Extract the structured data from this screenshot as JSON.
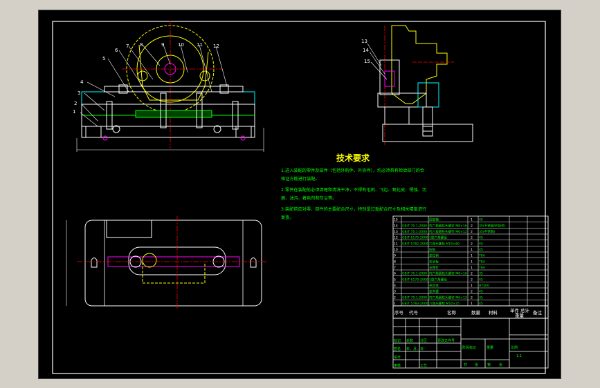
{
  "drawing": {
    "tech_title": "技术要求",
    "tech_lines": [
      "1.进入装配的零件及部件（包括外购件、外协件），均必须具有检验部门的合",
      "格证方能进行装配。",
      "2.零件在装配前必须清理和清洗干净，不得有毛刺、飞边、氧化皮、锈蚀、切",
      "屑、油污、着色剂和灰尘等。",
      "3.装配前应对零、部件的主要配合尺寸，特别是过盈配合尺寸及相关精度进行",
      "复查。"
    ],
    "callouts_front": [
      "1",
      "2",
      "3",
      "4",
      "5",
      "6",
      "7",
      "8",
      "9",
      "10",
      "11",
      "12"
    ],
    "callouts_side": [
      "13",
      "14",
      "15"
    ],
    "bom_rows": [
      {
        "no": "15",
        "code": "",
        "name": "固定轴",
        "qty": "1",
        "mat": "45",
        "note": ""
      },
      {
        "no": "14",
        "code": "GB/T 70.1-2000",
        "name": "内六角圆柱头螺钉 M8×16",
        "qty": "2",
        "mat": "35(不锈钢/外协件)",
        "note": ""
      },
      {
        "no": "13",
        "code": "GB/T 70.1-2000",
        "name": "内六角圆柱头螺钉 M6×12",
        "qty": "2",
        "mat": "35(不锈钢)",
        "note": ""
      },
      {
        "no": "12",
        "code": "GB/T 6170-2000",
        "name": "1型六角螺母",
        "qty": "2",
        "mat": "45",
        "note": ""
      },
      {
        "no": "11",
        "code": "GB/T 5782-2000",
        "name": "六角头螺栓 M10×80",
        "qty": "2",
        "mat": "45",
        "note": ""
      },
      {
        "no": "10",
        "code": "",
        "name": "压板",
        "qty": "1",
        "mat": "45",
        "note": ""
      },
      {
        "no": "9",
        "code": "",
        "name": "定位销",
        "qty": "1",
        "mat": "T8A",
        "note": ""
      },
      {
        "no": "8",
        "code": "",
        "name": "支承板",
        "qty": "1",
        "mat": "T8A",
        "note": ""
      },
      {
        "no": "7",
        "code": "",
        "name": "支撑钉",
        "qty": "1",
        "mat": "T8A",
        "note": ""
      },
      {
        "no": "6",
        "code": "GB/T 70.1-2000",
        "name": "内六角圆柱头螺钉 M8×16",
        "qty": "2",
        "mat": "35",
        "note": ""
      },
      {
        "no": "5",
        "code": "GB/T 6170-2000",
        "name": "1型六角螺母",
        "qty": "2",
        "mat": "45",
        "note": ""
      },
      {
        "no": "4",
        "code": "",
        "name": "夹具体",
        "qty": "1",
        "mat": "HT200",
        "note": ""
      },
      {
        "no": "3",
        "code": "",
        "name": "定向键",
        "qty": "2",
        "mat": "45",
        "note": ""
      },
      {
        "no": "2",
        "code": "GB/T 70.1-2000",
        "name": "内六角圆柱头螺钉 M6×12",
        "qty": "2",
        "mat": "35",
        "note": ""
      },
      {
        "no": "1",
        "code": "GB/T 5783-2000",
        "name": "六角头螺栓 M10×25",
        "qty": "1",
        "mat": "45",
        "note": ""
      }
    ],
    "bom_header": [
      "序号",
      "代号",
      "名称",
      "数量",
      "材料",
      "单件",
      "总计",
      "备注"
    ],
    "bom_header_sub": "重量",
    "title_block": {
      "left_labels": [
        "标记",
        "处数",
        "分区",
        "更改文件号",
        "签名",
        "年、月、日"
      ],
      "bottom_left": [
        "设计",
        "审核",
        "工艺"
      ],
      "mid_labels": [
        "阶段标记",
        "重量",
        "比例"
      ],
      "scale": "1:1",
      "sheet": [
        "共",
        "张",
        "第",
        "张"
      ]
    }
  }
}
